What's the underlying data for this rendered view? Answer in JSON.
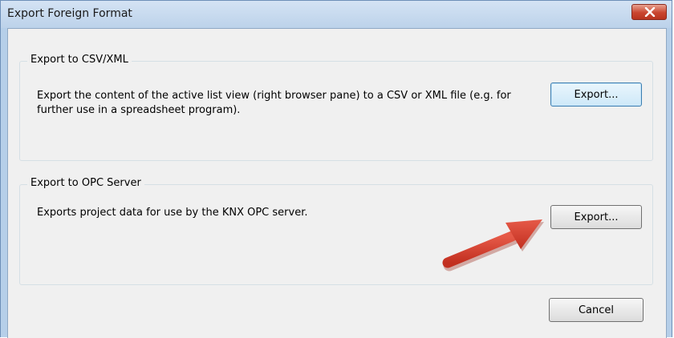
{
  "window": {
    "title": "Export Foreign Format",
    "close_icon": "close-icon"
  },
  "csv_group": {
    "legend": "Export to CSV/XML",
    "description": "Export the content of the active list view (right browser pane) to a CSV or XML file (e.g. for further use in a spreadsheet program).",
    "button_label": "Export..."
  },
  "opc_group": {
    "legend": "Export to OPC Server",
    "description": "Exports project data for use by the KNX OPC server.",
    "button_label": "Export..."
  },
  "footer": {
    "cancel_label": "Cancel"
  },
  "annotation": {
    "arrow_color": "#d93a2b",
    "arrow_icon": "red-arrow-icon"
  }
}
